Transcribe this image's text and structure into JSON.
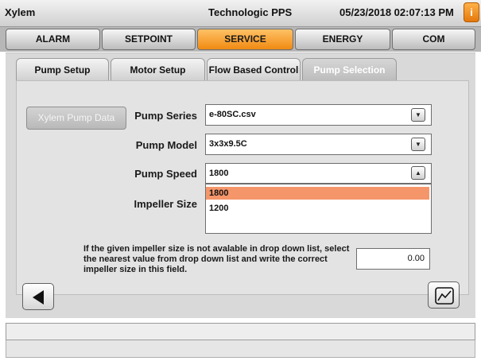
{
  "titlebar": {
    "app": "Xylem",
    "controller": "Technologic PPS",
    "datetime": "05/23/2018 02:07:13 PM",
    "info_label": "i"
  },
  "main_tabs": [
    {
      "label": "ALARM",
      "active": false
    },
    {
      "label": "SETPOINT",
      "active": false
    },
    {
      "label": "SERVICE",
      "active": true
    },
    {
      "label": "ENERGY",
      "active": false
    },
    {
      "label": "COM",
      "active": false
    }
  ],
  "sub_tabs": [
    {
      "label": "Pump Setup",
      "active": false
    },
    {
      "label": "Motor Setup",
      "active": false
    },
    {
      "label": "Flow Based Control",
      "active": false
    },
    {
      "label": "Pump Selection",
      "active": true
    }
  ],
  "xylem_button": "Xylem Pump Data",
  "form": {
    "pump_series": {
      "label": "Pump Series",
      "value": "e-80SC.csv"
    },
    "pump_model": {
      "label": "Pump Model",
      "value": "3x3x9.5C"
    },
    "pump_speed": {
      "label": "Pump Speed",
      "value": "1800",
      "options": [
        "1800",
        "1200"
      ],
      "selected": "1800"
    },
    "impeller_size": {
      "label": "Impeller Size"
    }
  },
  "note": "If the given impeller size is not avalable in drop down list, select the nearest value from drop down list and write the correct impeller size in this field.",
  "impeller_manual_value": "0.00",
  "colors": {
    "accent_tab": "#f08a12",
    "selected_option": "#f5966a"
  },
  "icons": {
    "back": "left-triangle",
    "chart": "trend-chart"
  }
}
